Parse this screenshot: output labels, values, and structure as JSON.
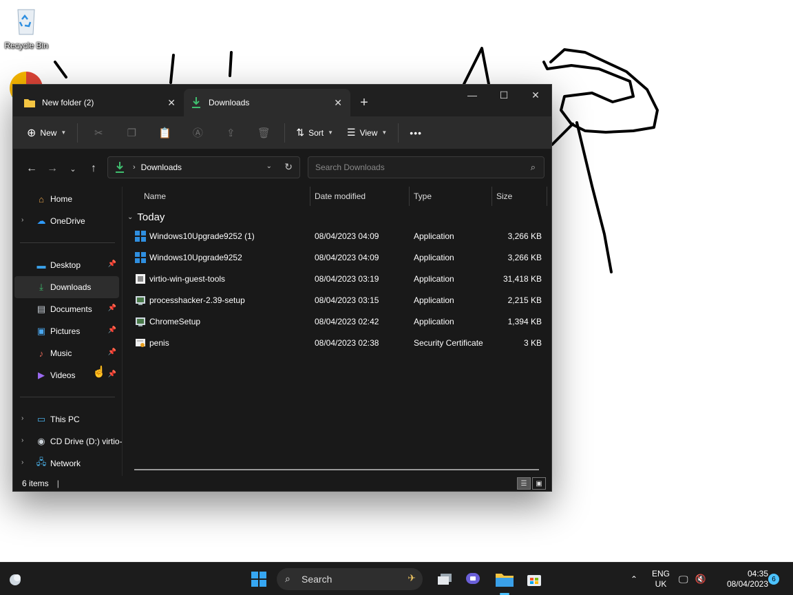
{
  "desktop": {
    "recycle_bin_label": "Recycle Bin"
  },
  "window": {
    "tabs": [
      {
        "label": "New folder (2)",
        "icon": "folder-icon",
        "active": false
      },
      {
        "label": "Downloads",
        "icon": "download-icon",
        "active": true
      }
    ],
    "new_tab_label": "+",
    "toolbar": {
      "new_label": "New",
      "sort_label": "Sort",
      "view_label": "View",
      "more_label": "•••"
    },
    "address": {
      "path_label": "Downloads",
      "search_placeholder": "Search Downloads"
    },
    "sidebar": {
      "top": [
        {
          "label": "Home",
          "icon": "home-icon",
          "pinned": false
        },
        {
          "label": "OneDrive",
          "icon": "onedrive-icon",
          "pinned": false
        }
      ],
      "quick": [
        {
          "label": "Desktop",
          "icon": "desktop-icon",
          "pinned": true
        },
        {
          "label": "Downloads",
          "icon": "download-icon",
          "pinned": true,
          "selected": true
        },
        {
          "label": "Documents",
          "icon": "documents-icon",
          "pinned": true
        },
        {
          "label": "Pictures",
          "icon": "pictures-icon",
          "pinned": true
        },
        {
          "label": "Music",
          "icon": "music-icon",
          "pinned": true
        },
        {
          "label": "Videos",
          "icon": "videos-icon",
          "pinned": true
        }
      ],
      "bottom": [
        {
          "label": "This PC",
          "icon": "this-pc-icon"
        },
        {
          "label": "CD Drive (D:) virtio-",
          "icon": "cd-drive-icon"
        },
        {
          "label": "Network",
          "icon": "network-icon"
        }
      ]
    },
    "columns": {
      "name": "Name",
      "date": "Date modified",
      "type": "Type",
      "size": "Size"
    },
    "group_title": "Today",
    "files": [
      {
        "name": "Windows10Upgrade9252 (1)",
        "date": "08/04/2023 04:09",
        "type": "Application",
        "size": "3,266 KB",
        "icon": "windows-app-icon"
      },
      {
        "name": "Windows10Upgrade9252",
        "date": "08/04/2023 04:09",
        "type": "Application",
        "size": "3,266 KB",
        "icon": "windows-app-icon"
      },
      {
        "name": "virtio-win-guest-tools",
        "date": "08/04/2023 03:19",
        "type": "Application",
        "size": "31,418 KB",
        "icon": "installer-icon"
      },
      {
        "name": "processhacker-2.39-setup",
        "date": "08/04/2023 03:15",
        "type": "Application",
        "size": "2,215 KB",
        "icon": "setup-icon"
      },
      {
        "name": "ChromeSetup",
        "date": "08/04/2023 02:42",
        "type": "Application",
        "size": "1,394 KB",
        "icon": "setup-icon"
      },
      {
        "name": "penis",
        "date": "08/04/2023 02:38",
        "type": "Security Certificate",
        "size": "3 KB",
        "icon": "certificate-icon"
      }
    ],
    "status": {
      "item_count": "6 items"
    }
  },
  "taskbar": {
    "search_label": "Search",
    "language": "ENG",
    "region": "UK",
    "time": "04:35",
    "date": "08/04/2023",
    "notification_count": "6"
  },
  "colors": {
    "accent": "#4cc2ff",
    "window_bg": "#191919",
    "toolbar_bg": "#2c2c2c"
  }
}
